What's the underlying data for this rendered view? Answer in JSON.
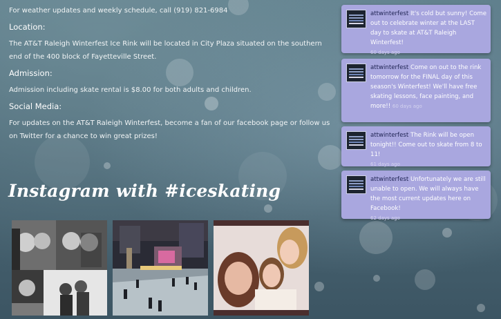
{
  "info": {
    "weather_line": "For weather updates and weekly schedule, call (919) 821-6984",
    "location_heading": "Location:",
    "location_text": "The AT&T Raleigh Winterfest Ice Rink will be located in City Plaza situated on the southern end of the 400 block of Fayetteville Street.",
    "admission_heading": "Admission:",
    "admission_text": "Admission including skate rental is $8.00 for both adults and children.",
    "social_heading": "Social Media:",
    "social_text": "For updates on the AT&T Raleigh Winterfest, become a fan of our facebook page or follow us on Twitter for a chance to win great prizes!"
  },
  "instagram": {
    "title": "Instagram with #iceskating"
  },
  "tweets": [
    {
      "user": "attwinterfest",
      "text": "It's cold but sunny! Come out to celebrate winter at the LAST day to skate at AT&T Raleigh Winterfest!",
      "time": "60 days ago"
    },
    {
      "user": "attwinterfest",
      "text": "Come on out to the rink tomorrow for the FINAL day of this season's Winterfest! We'll have free skating lessons, face painting, and more!!",
      "time": "60 days ago"
    },
    {
      "user": "attwinterfest",
      "text": "The Rink will be open tonight!! Come out to skate from 8 to 11!",
      "time": "61 days ago"
    },
    {
      "user": "attwinterfest",
      "text": "Unfortunately we are still unable to open. We will always have the most current updates here on Facebook!",
      "time": "62 days ago"
    }
  ]
}
